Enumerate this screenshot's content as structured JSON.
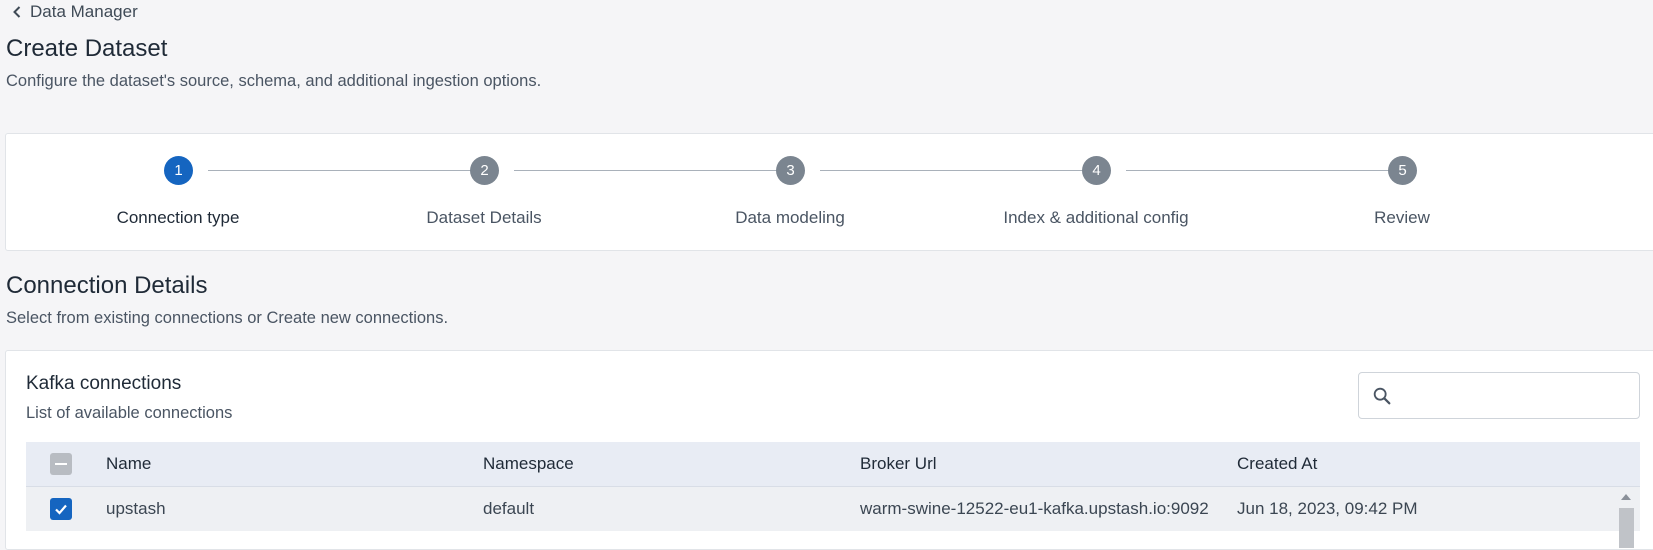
{
  "breadcrumb": {
    "back_label": "Data Manager"
  },
  "page": {
    "title": "Create Dataset",
    "subtitle": "Configure the dataset's source, schema, and additional ingestion options."
  },
  "stepper": {
    "steps": [
      {
        "number": "1",
        "label": "Connection type",
        "active": true
      },
      {
        "number": "2",
        "label": "Dataset Details",
        "active": false
      },
      {
        "number": "3",
        "label": "Data modeling",
        "active": false
      },
      {
        "number": "4",
        "label": "Index & additional config",
        "active": false
      },
      {
        "number": "5",
        "label": "Review",
        "active": false
      }
    ],
    "active_color": "#1565c0",
    "inactive_color": "#7b8590"
  },
  "section": {
    "title": "Connection Details",
    "subtitle": "Select from existing connections or Create new connections."
  },
  "card": {
    "title": "Kafka connections",
    "subtitle": "List of available connections",
    "search": {
      "placeholder": "",
      "value": ""
    }
  },
  "table": {
    "headers": {
      "name": "Name",
      "namespace": "Namespace",
      "broker_url": "Broker Url",
      "created_at": "Created At"
    },
    "rows": [
      {
        "selected": true,
        "name": "upstash",
        "namespace": "default",
        "broker_url": "warm-swine-12522-eu1-kafka.upstash.io:9092",
        "created_at": "Jun 18, 2023, 09:42 PM"
      }
    ]
  }
}
